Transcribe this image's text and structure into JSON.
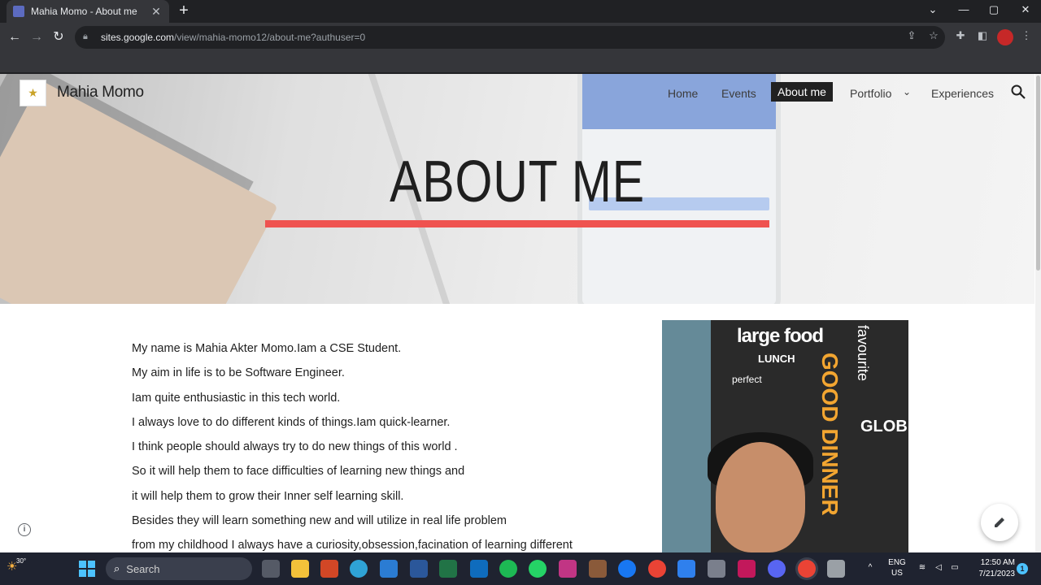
{
  "browser": {
    "tab_title": "Mahia Momo - About me",
    "new_tab_glyph": "+",
    "close_tab_glyph": "✕",
    "url_host": "sites.google.com",
    "url_path": "/view/mahia-momo12/about-me?authuser=0"
  },
  "site": {
    "name": "Mahia Momo",
    "nav": {
      "home": "Home",
      "events": "Events",
      "about": "About me",
      "portfolio": "Portfolio",
      "experiences": "Experiences"
    },
    "hero_title": "ABOUT ME",
    "accent_color": "#ef5350"
  },
  "content": {
    "lines": [
      "My name is Mahia Akter Momo.Iam a CSE Student.",
      "My aim in life is to be Software Engineer.",
      "Iam quite enthusiastic in this tech world.",
      "I always love to do different kinds of things.Iam quick-learner.",
      "I think people should always try to do new things of this world .",
      "So it will help them to face difficulties of learning new things and",
      "it will help them to grow their Inner self learning skill.",
      "Besides they will learn something new and will utilize in real life problem",
      "from my childhood I always have a curiosity,obsession,facination of learning different"
    ]
  },
  "photo": {
    "words": [
      "large food",
      "LUNCH",
      "perfect",
      "GOOD DINNER",
      "GLOB",
      "favourite"
    ]
  },
  "taskbar": {
    "temperature": "30°",
    "search_placeholder": "Search",
    "language": "ENG",
    "region": "US",
    "time": "12:50 AM",
    "date": "7/21/2023",
    "notification_count": "1"
  }
}
